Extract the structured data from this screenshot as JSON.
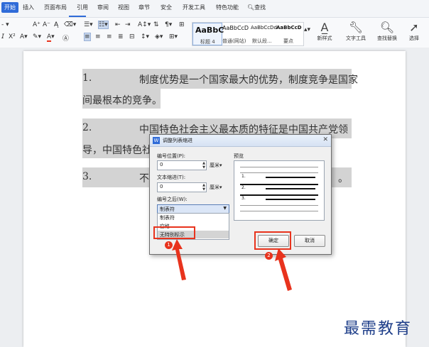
{
  "menu": {
    "tabs": [
      "开始",
      "插入",
      "页面布局",
      "引用",
      "审阅",
      "视图",
      "章节",
      "安全",
      "开发工具",
      "特色功能"
    ],
    "search": "查找"
  },
  "ribbon": {
    "font_size_value": "-",
    "styles": [
      {
        "sample": "AaBbC",
        "caption": "标题 4"
      },
      {
        "sample": "AaBbCcD",
        "caption": "普通(网站)"
      },
      {
        "sample": "AaBbCcDd",
        "caption": "默认段..."
      },
      {
        "sample": "AaBbCcD",
        "caption": "要点"
      }
    ],
    "new_style": "新样式",
    "text_tools": "文字工具",
    "find_replace": "查找替换",
    "select": "选择"
  },
  "document": {
    "items": [
      {
        "num": "1.",
        "line1": "制度优势是一个国家最大的优势，制度竞争是国家",
        "line2": "间最根本的竞争。"
      },
      {
        "num": "2.",
        "line1": "中国特色社会主义最本质的特征是中国共产党领",
        "line2": "导，中国特色社"
      },
      {
        "num": "3.",
        "line1": "不",
        "line2": ""
      }
    ],
    "tail_mark": "。"
  },
  "dialog": {
    "title": "调整列表缩进",
    "number_position_label": "编号位置(P):",
    "number_position_value": "0",
    "text_indent_label": "文本缩进(T):",
    "text_indent_value": "0",
    "unit": "厘米",
    "after_number_label": "编号之后(W):",
    "after_number_value": "制表符",
    "options": [
      "制表符",
      "空格",
      "无特别标示"
    ],
    "preview_label": "预览",
    "preview_numbers": [
      "1.",
      "2.",
      "3."
    ],
    "ok_label": "确定",
    "cancel_label": "取消"
  },
  "annotations": {
    "badge1": "1",
    "badge2": "2"
  },
  "watermark": "最需教育",
  "colors": {
    "accent": "#2f6bd8",
    "annotation_red": "#e8331d",
    "highlight": "#d3d3d3"
  }
}
